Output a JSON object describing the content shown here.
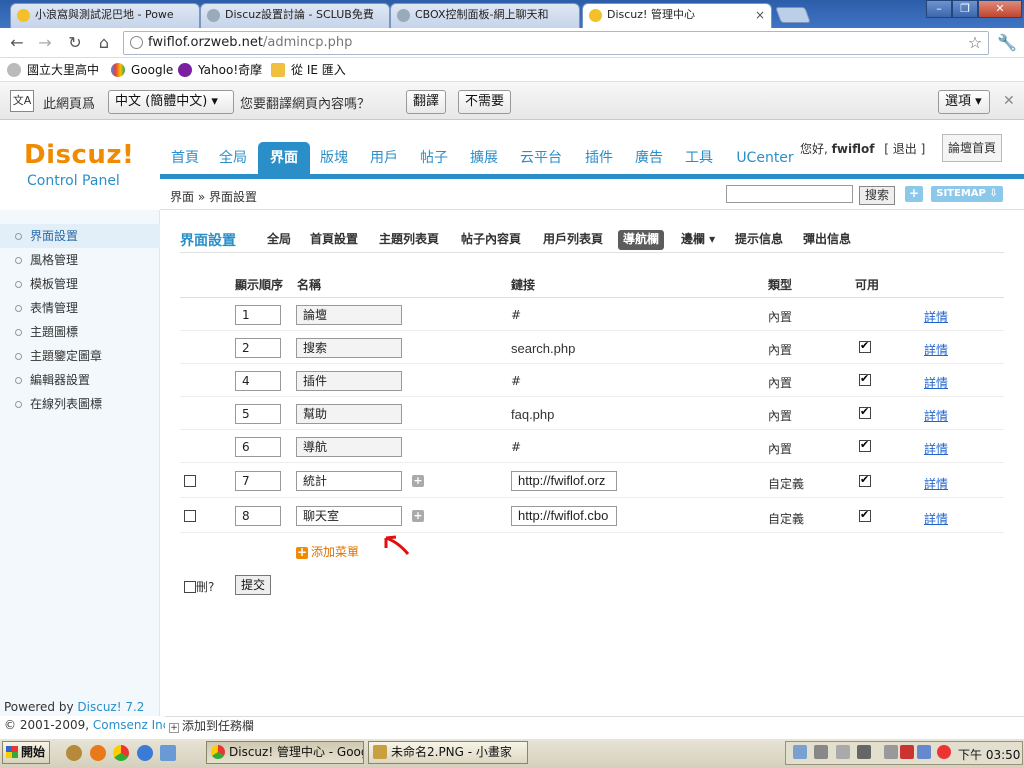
{
  "browser": {
    "tabs": [
      {
        "label": "小浪窩與測試泥巴地 - Powe",
        "icon": "discuz-icon"
      },
      {
        "label": "Discuz設置討論 - SCLUB免費",
        "icon": "globe-icon"
      },
      {
        "label": "CBOX控制面板-網上聊天和",
        "icon": "globe-icon"
      },
      {
        "label": "Discuz! 管理中心",
        "icon": "discuz-icon"
      }
    ],
    "url_host": "fwiflof.orzweb.net",
    "url_path": "/admincp.php",
    "bookmarks": [
      "國立大里高中",
      "Google",
      "Yahoo!奇摩",
      "從 IE 匯入"
    ],
    "translate": {
      "prefix": "此網頁爲",
      "language": "中文 (簡體中文)",
      "question": "您要翻譯網頁內容嗎？",
      "translate_btn": "翻譯",
      "no_btn": "不需要",
      "options_btn": "選項"
    }
  },
  "header": {
    "logo_main": "Discuz!",
    "logo_sub": "Control Panel",
    "nav": [
      "首頁",
      "全局",
      "界面",
      "版塊",
      "用戶",
      "帖子",
      "擴展",
      "云平台",
      "插件",
      "廣告",
      "工具",
      "UCenter"
    ],
    "active_nav": "界面",
    "greeting": "您好,",
    "username": "fwiflof",
    "logout": "[ 退出 ]",
    "forum_home": "論壇首頁",
    "breadcrumb": "界面 » 界面設置",
    "search_btn": "搜索",
    "plus": "+",
    "sitemap": "SITEMAP"
  },
  "sidebar": {
    "items": [
      "界面設置",
      "風格管理",
      "模板管理",
      "表情管理",
      "主題圖標",
      "主題鑒定圖章",
      "編輯器設置",
      "在線列表圖標"
    ],
    "powered_by": "Powered by",
    "powered_link": "Discuz! 7.2",
    "copyright": "© 2001-2009,",
    "copyright_link": "Comsenz Inc.",
    "add_taskbar": "添加到任務欄"
  },
  "main": {
    "title": "界面設置",
    "subnav": [
      "全局",
      "首頁設置",
      "主題列表頁",
      "帖子內容頁",
      "用戶列表頁",
      "導航欄",
      "邊欄 ▾",
      "提示信息",
      "彈出信息"
    ],
    "active_sub": "導航欄",
    "columns": [
      "顯示順序",
      "名稱",
      "鏈接",
      "類型",
      "可用"
    ],
    "rows": [
      {
        "order": "1",
        "name": "論壇",
        "link": "#",
        "type": "內置",
        "enabled": false,
        "deletable": false,
        "detail": "詳情"
      },
      {
        "order": "2",
        "name": "搜索",
        "link": "search.php",
        "type": "內置",
        "enabled": true,
        "deletable": false,
        "detail": "詳情"
      },
      {
        "order": "4",
        "name": "插件",
        "link": "#",
        "type": "內置",
        "enabled": true,
        "deletable": false,
        "detail": "詳情"
      },
      {
        "order": "5",
        "name": "幫助",
        "link": "faq.php",
        "type": "內置",
        "enabled": true,
        "deletable": false,
        "detail": "詳情"
      },
      {
        "order": "6",
        "name": "導航",
        "link": "#",
        "type": "內置",
        "enabled": true,
        "deletable": false,
        "detail": "詳情"
      },
      {
        "order": "7",
        "name": "統計",
        "link": "http://fwiflof.orz",
        "type": "自定義",
        "enabled": true,
        "deletable": true,
        "detail": "詳情"
      },
      {
        "order": "8",
        "name": "聊天室",
        "link": "http://fwiflof.cbo",
        "type": "自定義",
        "enabled": true,
        "deletable": true,
        "detail": "詳情"
      }
    ],
    "add_menu": "添加菜單",
    "delete_label": "刪?",
    "submit": "提交"
  },
  "taskbar": {
    "start": "開始",
    "tasks": [
      "Discuz! 管理中心 - Goog...",
      "未命名2.PNG - 小畫家"
    ],
    "clock": "下午 03:50"
  }
}
